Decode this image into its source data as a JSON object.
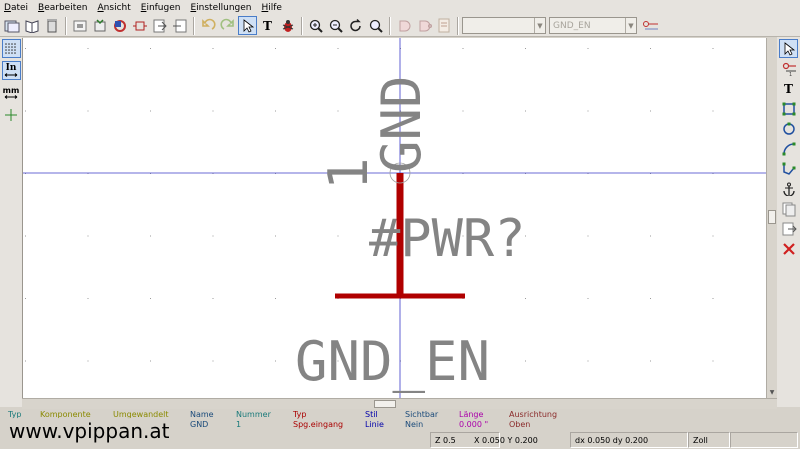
{
  "menu": [
    {
      "label": "Datei",
      "u": "D",
      "rest": "atei"
    },
    {
      "label": "Bearbeiten",
      "u": "B",
      "rest": "earbeiten"
    },
    {
      "label": "Ansicht",
      "u": "A",
      "rest": "nsicht"
    },
    {
      "label": "Einfugen",
      "u": "E",
      "rest": "infugen"
    },
    {
      "label": "Einstellungen",
      "u": "E",
      "rest": "instellungen"
    },
    {
      "label": "Hilfe",
      "u": "H",
      "rest": "ilfe"
    }
  ],
  "toolbar": {
    "combo1_value": "",
    "combo2_value": "GND_EN"
  },
  "left_toolbar": {
    "units_in": "In",
    "units_mm": "mm"
  },
  "symbol": {
    "pin_number": "1",
    "pin_name": "GND",
    "reference": "#PWR?",
    "value": "GND_EN"
  },
  "info": [
    {
      "label": "Typ",
      "value": "",
      "color": "#1a7a7a"
    },
    {
      "label": "Komponente",
      "value": "",
      "color": "#8a8a00"
    },
    {
      "label": "Umgewandelt",
      "value": "",
      "color": "#8a8a00"
    },
    {
      "label": "Name",
      "value": "GND",
      "color": "#1a4a7a"
    },
    {
      "label": "Nummer",
      "value": "1",
      "color": "#1a7a7a"
    },
    {
      "label": "Typ",
      "value": "Spg.eingang",
      "color": "#aa0000"
    },
    {
      "label": "Stil",
      "value": "Linie",
      "color": "#0000aa"
    },
    {
      "label": "Sichtbar",
      "value": "Nein",
      "color": "#1a4a7a"
    },
    {
      "label": "Länge",
      "value": "0.000 \"",
      "color": "#aa00aa"
    },
    {
      "label": "Ausrichtung",
      "value": "Oben",
      "color": "#8a2a2a"
    }
  ],
  "status": {
    "zoom": "Z 0.5",
    "abs": "X 0.050  Y 0.200",
    "rel": "dx 0.050  dy 0.200",
    "units": "Zoll"
  },
  "watermark": "www.vpippan.at",
  "colors": {
    "pin": "#b00000",
    "text": "#848484",
    "grid": "#9a9a9a",
    "cursor": "#3a3ac8"
  }
}
